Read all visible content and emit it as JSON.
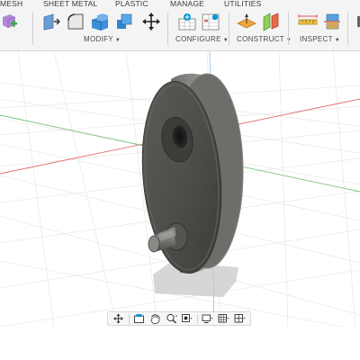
{
  "toolbar": {
    "tabs": [
      {
        "label": "MESH"
      },
      {
        "label": "SHEET METAL"
      },
      {
        "label": "PLASTIC"
      },
      {
        "label": "MANAGE"
      },
      {
        "label": "UTILITIES"
      }
    ],
    "groups": {
      "modify": "MODIFY",
      "configure": "CONFIGURE",
      "construct": "CONSTRUCT",
      "inspect": "INSPECT"
    }
  },
  "colors": {
    "accent": "#0696d7",
    "part_dark": "#4d4d4a",
    "grid_red": "#e26b6b",
    "grid_green": "#7cc27c",
    "grid_blue": "#7aa5d9"
  },
  "navbar": {
    "items": [
      "orbit-icon",
      "look-at-icon",
      "pan-icon",
      "zoom-icon",
      "fit-icon",
      "display-settings-icon",
      "grid-settings-icon",
      "viewports-icon"
    ]
  }
}
